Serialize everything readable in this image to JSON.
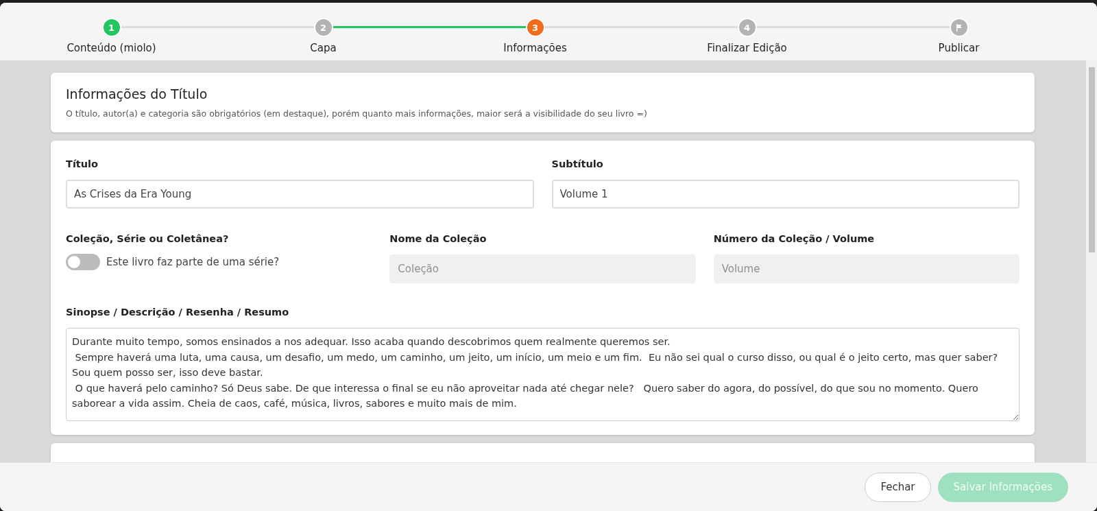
{
  "steps": [
    {
      "number": "1",
      "label": "Conteúdo (miolo)",
      "completed": true,
      "selected": false,
      "kind": "number",
      "connector_active": false
    },
    {
      "number": "2",
      "label": "Capa",
      "completed": false,
      "selected": false,
      "kind": "number",
      "connector_active": true
    },
    {
      "number": "3",
      "label": "Informações",
      "completed": false,
      "selected": true,
      "kind": "number",
      "connector_active": false
    },
    {
      "number": "4",
      "label": "Finalizar Edição",
      "completed": false,
      "selected": false,
      "kind": "number",
      "connector_active": false
    },
    {
      "label": "Publicar",
      "completed": false,
      "selected": false,
      "kind": "flag"
    }
  ],
  "header_card": {
    "title": "Informações do Título",
    "description": "O título, autor(a) e categoria são obrigatórios (em destaque), porém quanto mais informações, maior será a visibilidade do seu livro =)"
  },
  "form": {
    "titulo": {
      "label": "Título",
      "value": "As Crises da Era Young"
    },
    "subtitulo": {
      "label": "Subtítulo",
      "value": "Volume 1"
    },
    "colecao": {
      "label": "Coleção, Série ou Coletânea?",
      "toggle_text": "Este livro faz parte de uma série?",
      "on": false
    },
    "nome_colecao": {
      "label": "Nome da Coleção",
      "placeholder": "Coleção",
      "disabled": true
    },
    "numero_colecao": {
      "label": "Número da Coleção / Volume",
      "placeholder": "Volume",
      "disabled": true
    },
    "sinopse": {
      "label": "Sinopse / Descrição / Resenha / Resumo",
      "value": "Durante muito tempo, somos ensinados a nos adequar. Isso acaba quando descobrimos quem realmente queremos ser.\n Sempre haverá uma luta, uma causa, um desafio, um medo, um caminho, um jeito, um início, um meio e um fim.  Eu não sei qual o curso disso, ou qual é o jeito certo, mas quer saber? Sou quem posso ser, isso deve bastar.\n O que haverá pelo caminho? Só Deus sabe. De que interessa o final se eu não aproveitar nada até chegar nele?   Quero saber do agora, do possível, do que sou no momento. Quero saborear a vida assim. Cheia de caos, café, música, livros, sabores e muito mais de mim."
    }
  },
  "footer": {
    "buttons": [
      {
        "label": "Fechar",
        "kind": "secondary",
        "disabled": false
      },
      {
        "label": "Salvar Informações",
        "kind": "primary",
        "disabled": true
      }
    ]
  }
}
